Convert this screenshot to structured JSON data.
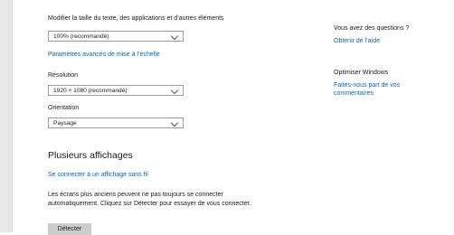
{
  "display": {
    "scale_label": "Modifier la taille du texte, des applications et d’autres éléments",
    "scale_value": "100% (recommandé)",
    "advanced_scaling_link": "Paramètres avancés de mise à l’échelle",
    "resolution_label": "Résolution",
    "resolution_value": "1920 × 1080 (recommandé)",
    "orientation_label": "Orientation",
    "orientation_value": "Paysage",
    "multi_heading": "Plusieurs affichages",
    "wireless_link": "Se connecter à un affichage sans fil",
    "detect_text": "Les écrans plus anciens peuvent ne pas toujours se connecter automatiquement. Cliquez sur Détecter pour essayer de vous connecter.",
    "detect_button": "Détecter"
  },
  "help": {
    "questions_title": "Vous avez des questions ?",
    "help_link": "Obtenir de l’aide",
    "improve_title": "Optimiser Windows",
    "feedback_link": "Faites-nous part de vos commentaires"
  }
}
